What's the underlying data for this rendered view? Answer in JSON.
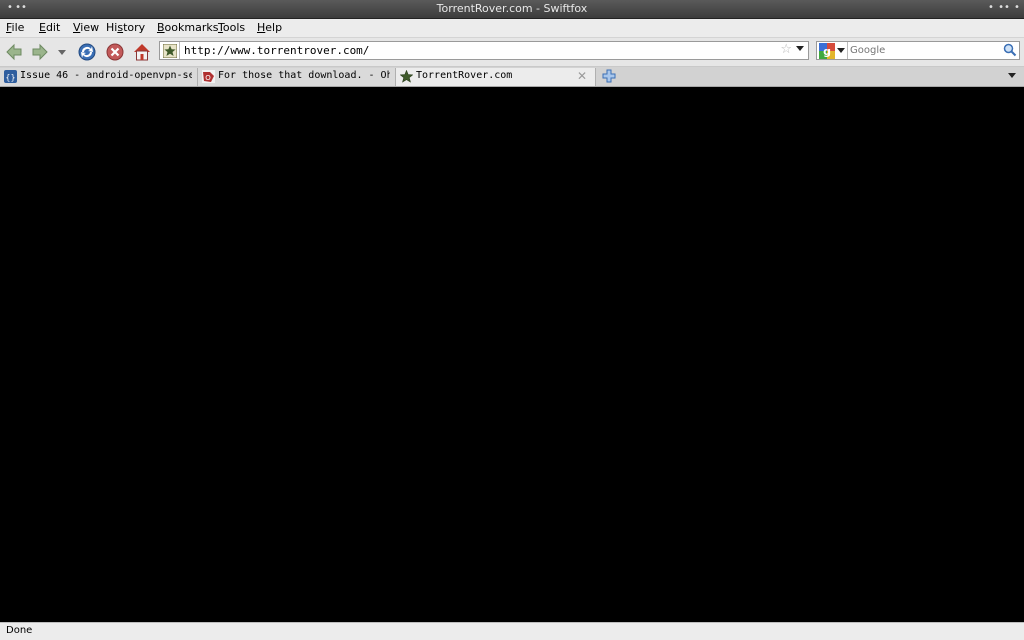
{
  "window": {
    "title": "TorrentRover.com - Swiftfox"
  },
  "menu": {
    "items": [
      {
        "pre": "",
        "key": "F",
        "post": "ile"
      },
      {
        "pre": "",
        "key": "E",
        "post": "dit"
      },
      {
        "pre": "",
        "key": "V",
        "post": "iew"
      },
      {
        "pre": "Hi",
        "key": "s",
        "post": "tory"
      },
      {
        "pre": "",
        "key": "B",
        "post": "ookmarks"
      },
      {
        "pre": "",
        "key": "T",
        "post": "ools"
      },
      {
        "pre": "",
        "key": "H",
        "post": "elp"
      }
    ]
  },
  "nav": {
    "url": "http://www.torrentrover.com/",
    "search_placeholder": "Google"
  },
  "tabs": [
    {
      "label": "Issue 46 - android-openvpn-set…",
      "favicon": "google-code-icon",
      "active": false
    },
    {
      "label": "For those that download. - Ohi…",
      "favicon": "ohio-icon",
      "active": false
    },
    {
      "label": "TorrentRover.com",
      "favicon": "star-badge-icon",
      "active": true
    }
  ],
  "status": {
    "text": "Done"
  },
  "colors": {
    "chrome": "#ececec",
    "content": "#000000",
    "titlebar": "#4a4a4a"
  }
}
